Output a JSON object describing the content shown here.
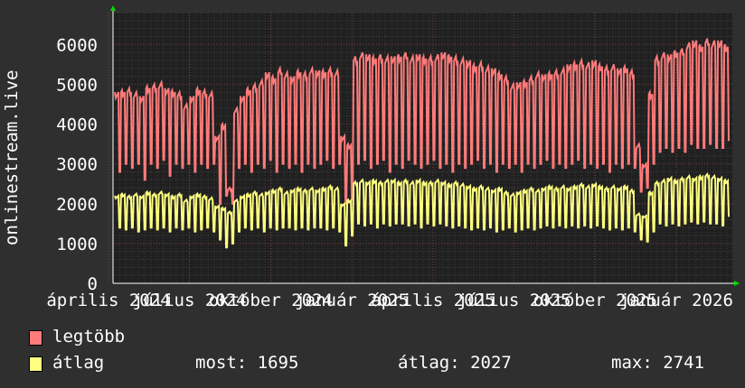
{
  "chart_data": {
    "type": "line",
    "ylabel": "onlinestream.live",
    "ylim": [
      0,
      6800
    ],
    "yticks": [
      0,
      1000,
      2000,
      3000,
      4000,
      5000,
      6000
    ],
    "xtick_labels": [
      "április 2024",
      "július 2024",
      "október 2024",
      "január 2025",
      "április 2025",
      "július 2025",
      "október 2025",
      "január 2026"
    ],
    "grid": true,
    "x_unit": "weeks, weekday peak / weekend low, daily resolution",
    "series": [
      {
        "name": "legtöbb",
        "color": "#ff7b7b",
        "weekly_high": [
          4800,
          4850,
          4900,
          4800,
          4700,
          4950,
          5000,
          5050,
          4900,
          4850,
          4800,
          4500,
          4700,
          4900,
          4850,
          4800,
          3700,
          4000,
          2400,
          4400,
          4700,
          4900,
          5000,
          5100,
          5300,
          5200,
          5400,
          5300,
          5200,
          5350,
          5300,
          5400,
          5350,
          5350,
          5400,
          5350,
          3700,
          3500,
          5700,
          5800,
          5750,
          5700,
          5750,
          5700,
          5700,
          5750,
          5800,
          5700,
          5750,
          5700,
          5700,
          5750,
          5800,
          5750,
          5700,
          5650,
          5600,
          5500,
          5550,
          5450,
          5400,
          5300,
          5200,
          5000,
          5050,
          5100,
          5200,
          5300,
          5250,
          5300,
          5350,
          5400,
          5500,
          5550,
          5600,
          5550,
          5600,
          5500,
          5450,
          5500,
          5400,
          5450,
          5350,
          3500,
          3000,
          4800,
          5700,
          5800,
          5750,
          5850,
          5900,
          6050,
          6100,
          6000,
          6150,
          6100,
          6100,
          6000
        ],
        "weekly_low": [
          2800,
          3000,
          2900,
          3000,
          2600,
          3000,
          2900,
          3100,
          2700,
          3000,
          2900,
          3000,
          2800,
          3000,
          2900,
          3000,
          2000,
          2200,
          2000,
          2900,
          3000,
          2800,
          3000,
          2900,
          3100,
          2800,
          3000,
          2900,
          3000,
          2800,
          3000,
          2900,
          3000,
          3100,
          2900,
          3000,
          2000,
          2100,
          3000,
          3100,
          2900,
          3000,
          3100,
          2800,
          3000,
          2900,
          3100,
          3000,
          2900,
          3000,
          3100,
          2900,
          3000,
          2800,
          3000,
          2900,
          3000,
          3100,
          2900,
          3000,
          2800,
          3000,
          2900,
          3000,
          2800,
          3000,
          2900,
          3000,
          3100,
          2900,
          3000,
          2900,
          3000,
          3100,
          2900,
          3000,
          2900,
          3000,
          2800,
          3000,
          2900,
          3000,
          2900,
          2300,
          2400,
          3000,
          3300,
          3400,
          3300,
          3400,
          3300,
          3500,
          3400,
          3400,
          3500,
          3400,
          3400,
          3600
        ]
      },
      {
        "name": "átlag",
        "color": "#ffff80",
        "weekly_high": [
          2200,
          2250,
          2200,
          2250,
          2200,
          2300,
          2250,
          2300,
          2250,
          2200,
          2250,
          2100,
          2200,
          2250,
          2200,
          2150,
          1950,
          1900,
          1800,
          2100,
          2200,
          2250,
          2300,
          2250,
          2300,
          2350,
          2400,
          2300,
          2350,
          2400,
          2350,
          2400,
          2350,
          2400,
          2450,
          2400,
          2000,
          2100,
          2550,
          2600,
          2550,
          2600,
          2550,
          2600,
          2600,
          2550,
          2600,
          2550,
          2600,
          2550,
          2550,
          2600,
          2550,
          2500,
          2550,
          2500,
          2450,
          2400,
          2450,
          2400,
          2350,
          2400,
          2300,
          2250,
          2300,
          2350,
          2400,
          2350,
          2400,
          2450,
          2400,
          2450,
          2400,
          2450,
          2500,
          2450,
          2500,
          2450,
          2400,
          2450,
          2400,
          2450,
          2350,
          1750,
          1700,
          2300,
          2550,
          2600,
          2650,
          2600,
          2650,
          2700,
          2650,
          2700,
          2741,
          2700,
          2650,
          2600
        ],
        "weekly_low": [
          1400,
          1350,
          1400,
          1300,
          1350,
          1400,
          1350,
          1400,
          1300,
          1400,
          1350,
          1400,
          1300,
          1350,
          1400,
          1300,
          1100,
          900,
          1000,
          1300,
          1400,
          1350,
          1400,
          1300,
          1400,
          1350,
          1400,
          1400,
          1350,
          1400,
          1350,
          1400,
          1400,
          1350,
          1400,
          1300,
          950,
          1200,
          1500,
          1450,
          1500,
          1400,
          1500,
          1450,
          1500,
          1500,
          1450,
          1500,
          1400,
          1500,
          1450,
          1500,
          1450,
          1400,
          1450,
          1400,
          1350,
          1400,
          1350,
          1400,
          1300,
          1350,
          1400,
          1300,
          1350,
          1400,
          1350,
          1400,
          1450,
          1400,
          1450,
          1400,
          1450,
          1400,
          1450,
          1400,
          1450,
          1400,
          1350,
          1400,
          1350,
          1400,
          1300,
          1100,
          1050,
          1300,
          1500,
          1450,
          1500,
          1450,
          1500,
          1550,
          1500,
          1550,
          1500,
          1500,
          1450,
          1695
        ]
      }
    ]
  },
  "legend": {
    "max_label": "legtöbb",
    "avg_label": "átlag",
    "now_text": "most: 1695",
    "avg_text": "átlag: 2027",
    "max_text": "max: 2741"
  }
}
